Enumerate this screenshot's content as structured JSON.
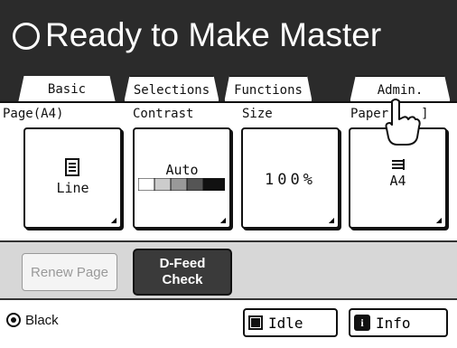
{
  "header": {
    "title": "Ready to Make Master"
  },
  "tabs": [
    {
      "label": "Basic",
      "active": true
    },
    {
      "label": "Selections"
    },
    {
      "label": "Functions"
    },
    {
      "label": "Admin."
    }
  ],
  "settings": {
    "page": {
      "label": "Page(A4)",
      "value": "Line"
    },
    "contrast": {
      "label": "Contrast",
      "value": "Auto"
    },
    "size": {
      "label": "Size",
      "value": "100%"
    },
    "paper": {
      "label": "Paper",
      "value": "A4"
    }
  },
  "actions": {
    "renew_page": "Renew Page",
    "dfeed_line1": "D-Feed",
    "dfeed_line2": "Check"
  },
  "statusbar": {
    "ink_color": "Black",
    "idle_label": "Idle",
    "info_label": "Info"
  }
}
